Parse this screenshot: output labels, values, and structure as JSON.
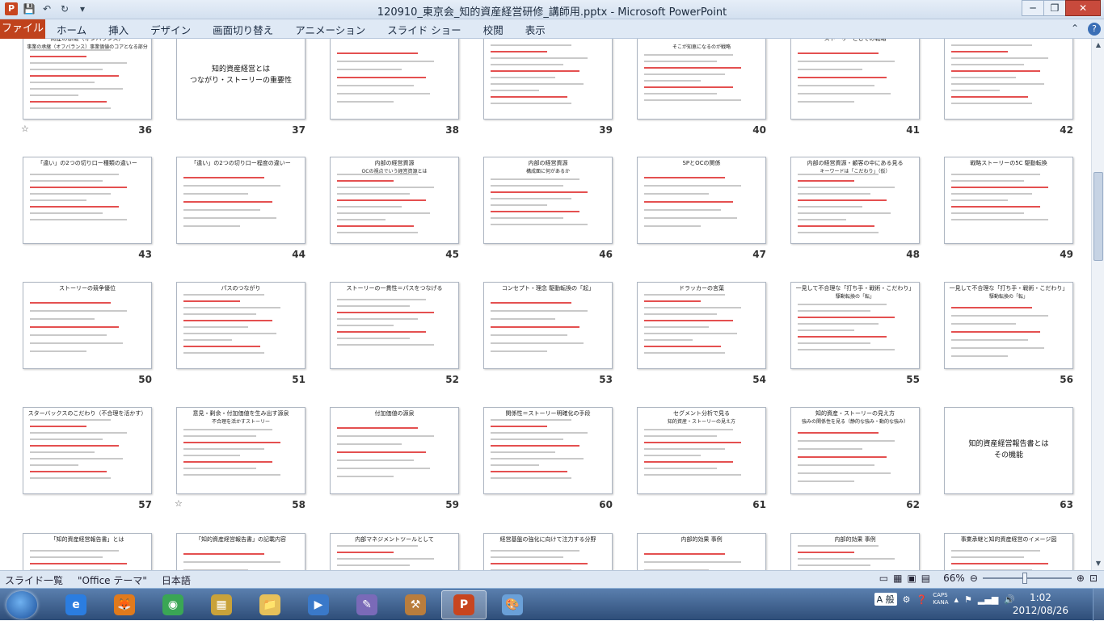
{
  "window": {
    "title": "120910_東京会_知的資産経営研修_講師用.pptx - Microsoft PowerPoint",
    "app_icon": "P"
  },
  "ribbon": {
    "file_tab": "ファイル",
    "tabs": [
      "ホーム",
      "挿入",
      "デザイン",
      "画面切り替え",
      "アニメーション",
      "スライド ショー",
      "校閲",
      "表示"
    ]
  },
  "slides": [
    {
      "num": "36",
      "star": true,
      "title": "財産の承継（オンバランス）",
      "subtitle": "事業の承継（オフバランス）事業価値のコアとなる部分"
    },
    {
      "num": "37",
      "star": false,
      "title": "知的資産経営とは",
      "subtitle": "つながり・ストーリーの重要性"
    },
    {
      "num": "38",
      "star": false,
      "title": "",
      "subtitle": ""
    },
    {
      "num": "39",
      "star": false,
      "title": "",
      "subtitle": ""
    },
    {
      "num": "40",
      "star": false,
      "title": "",
      "subtitle": "そこが知恵になるのが戦略"
    },
    {
      "num": "41",
      "star": false,
      "title": "ストーリーとしての戦略",
      "subtitle": ""
    },
    {
      "num": "42",
      "star": false,
      "title": "",
      "subtitle": ""
    },
    {
      "num": "43",
      "star": false,
      "title": "「違い」の2つの切り口ー種類の違いー",
      "subtitle": ""
    },
    {
      "num": "44",
      "star": false,
      "title": "「違い」の2つの切り口ー程度の違いー",
      "subtitle": ""
    },
    {
      "num": "45",
      "star": false,
      "title": "内部の経営資源",
      "subtitle": "OCの視点でいう経営資源とは"
    },
    {
      "num": "46",
      "star": false,
      "title": "内部の経営資源",
      "subtitle": "構成面に何があるか"
    },
    {
      "num": "47",
      "star": false,
      "title": "SPとOCの関係",
      "subtitle": ""
    },
    {
      "num": "48",
      "star": false,
      "title": "内部の経営資源・顧客の中にある見る",
      "subtitle": "キーワードは「こだわり」（仮）"
    },
    {
      "num": "49",
      "star": false,
      "title": "戦略ストーリーの5C 駆動転換",
      "subtitle": ""
    },
    {
      "num": "50",
      "star": false,
      "title": "ストーリーの競争優位",
      "subtitle": ""
    },
    {
      "num": "51",
      "star": false,
      "title": "パスのつながり",
      "subtitle": ""
    },
    {
      "num": "52",
      "star": false,
      "title": "ストーリーの一貫性＝パスをつなげる",
      "subtitle": ""
    },
    {
      "num": "53",
      "star": false,
      "title": "コンセプト・理念 駆動転換の「起」",
      "subtitle": ""
    },
    {
      "num": "54",
      "star": false,
      "title": "ドラッカーの言葉",
      "subtitle": ""
    },
    {
      "num": "55",
      "star": false,
      "title": "一見して不合理な「打ち手・戦術・こだわり」",
      "subtitle": "駆動転換の「転」"
    },
    {
      "num": "56",
      "star": false,
      "title": "一見して不合理な「打ち手・戦術・こだわり」",
      "subtitle": "駆動転換の「転」"
    },
    {
      "num": "57",
      "star": false,
      "title": "スターバックスのこだわり（不合理を活かす）",
      "subtitle": ""
    },
    {
      "num": "58",
      "star": true,
      "title": "意見・剰余・付加価値を生み出す源泉",
      "subtitle": "不合理を活かすストーリー"
    },
    {
      "num": "59",
      "star": false,
      "title": "付加価値の源泉",
      "subtitle": ""
    },
    {
      "num": "60",
      "star": false,
      "title": "関係性＝ストーリー明確化の手段",
      "subtitle": ""
    },
    {
      "num": "61",
      "star": false,
      "title": "セグメント分析で見る",
      "subtitle": "知的資産・ストーリーの見え方"
    },
    {
      "num": "62",
      "star": false,
      "title": "知的資産・ストーリーの見え方",
      "subtitle": "強みの関係性を見る（静的な強み・動的な強み）"
    },
    {
      "num": "63",
      "star": false,
      "title": "知的資産経営報告書とは",
      "subtitle": "その機能"
    },
    {
      "num": "64",
      "star": false,
      "title": "「知的資産経営報告書」とは",
      "subtitle": ""
    },
    {
      "num": "65",
      "star": false,
      "title": "「知的資産経営報告書」の記載内容",
      "subtitle": ""
    },
    {
      "num": "66",
      "star": false,
      "title": "内部マネジメントツールとして",
      "subtitle": ""
    },
    {
      "num": "67",
      "star": false,
      "title": "経営基盤の強化に向けて注力する分野",
      "subtitle": ""
    },
    {
      "num": "68",
      "star": false,
      "title": "内部的効果 事例",
      "subtitle": ""
    },
    {
      "num": "69",
      "star": false,
      "title": "内部的効果 事例",
      "subtitle": ""
    },
    {
      "num": "70",
      "star": false,
      "title": "事業承継と知的資産経営のイメージ図",
      "subtitle": ""
    }
  ],
  "statusbar": {
    "view": "スライド一覧",
    "theme": "\"Office テーマ\"",
    "language": "日本語",
    "zoom": "66%",
    "zoom_fraction": 0.47
  },
  "taskbar": {
    "apps": [
      "Internet Explorer",
      "Firefox",
      "Chrome",
      "Explorer",
      "Folder",
      "Media Player",
      "Paint",
      "Tool",
      "PowerPoint",
      "Palette"
    ],
    "active_index": 8,
    "tray_text": "A 般",
    "caps": "CAPS",
    "kana": "KANA",
    "time": "1:02",
    "date": "2012/08/26"
  }
}
